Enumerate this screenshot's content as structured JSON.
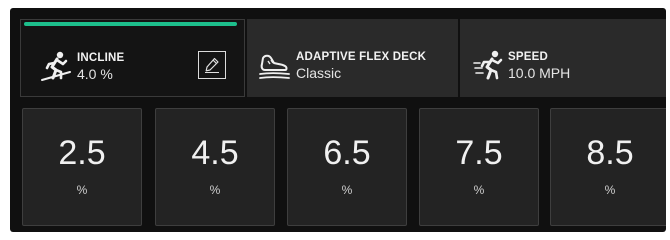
{
  "tabs": {
    "incline": {
      "title": "INCLINE",
      "value": "4.0 %",
      "icon": "incline-runner-icon",
      "active": true
    },
    "deck": {
      "title": "ADAPTIVE FLEX DECK",
      "value": "Classic",
      "icon": "shoe-deck-icon"
    },
    "speed": {
      "title": "SPEED",
      "value": "10.0 MPH",
      "icon": "speed-runner-icon"
    },
    "edit_icon": "pencil-icon"
  },
  "presets": [
    {
      "value": "2.5",
      "unit": "%"
    },
    {
      "value": "4.5",
      "unit": "%"
    },
    {
      "value": "6.5",
      "unit": "%"
    },
    {
      "value": "7.5",
      "unit": "%"
    },
    {
      "value": "8.5",
      "unit": "%"
    }
  ],
  "colors": {
    "accent": "#1dbf8c",
    "background": "#101010",
    "tile": "#232323"
  }
}
